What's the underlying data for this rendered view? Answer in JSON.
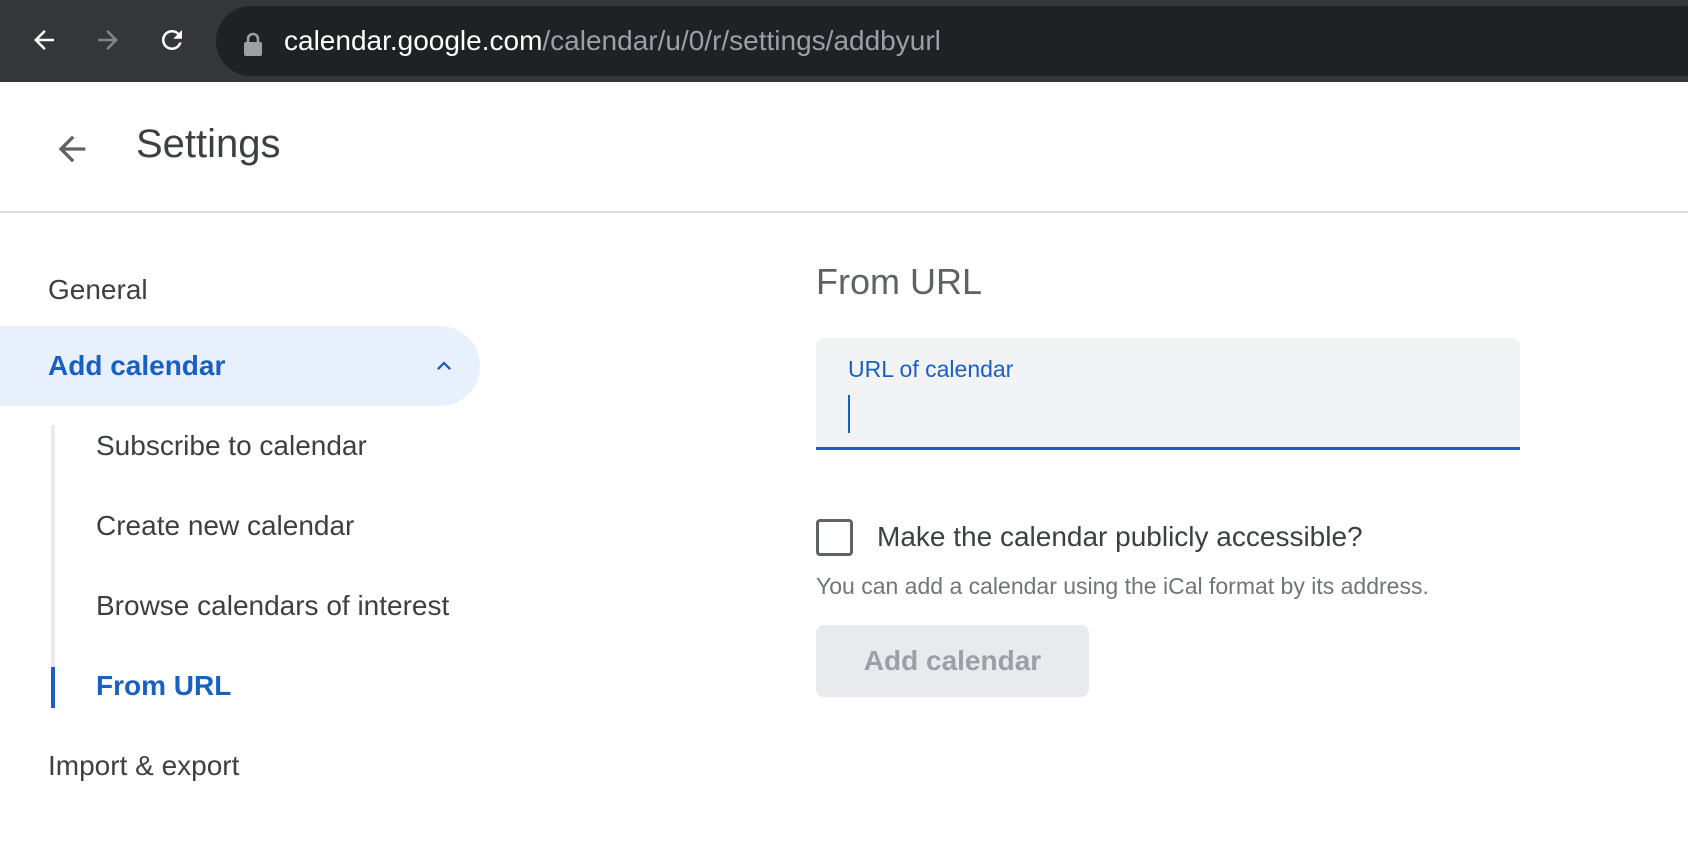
{
  "browser": {
    "url_host": "calendar.google.com",
    "url_path": "/calendar/u/0/r/settings/addbyurl"
  },
  "header": {
    "title": "Settings"
  },
  "sidebar": {
    "general_label": "General",
    "add_calendar_label": "Add calendar",
    "sub_items": [
      {
        "label": "Subscribe to calendar"
      },
      {
        "label": "Create new calendar"
      },
      {
        "label": "Browse calendars of interest"
      },
      {
        "label": "From URL"
      }
    ],
    "import_export_label": "Import & export"
  },
  "main": {
    "section_title": "From URL",
    "url_field": {
      "label": "URL of calendar",
      "value": ""
    },
    "public_checkbox": {
      "label": "Make the calendar publicly accessible?",
      "checked": false
    },
    "helper_text": "You can add a calendar using the iCal format by its address.",
    "add_button_label": "Add calendar"
  },
  "colors": {
    "accent": "#1a5fc4",
    "active_bg": "#e8f0fe",
    "chrome_bg": "#35363a",
    "omnibox_bg": "#202124"
  }
}
